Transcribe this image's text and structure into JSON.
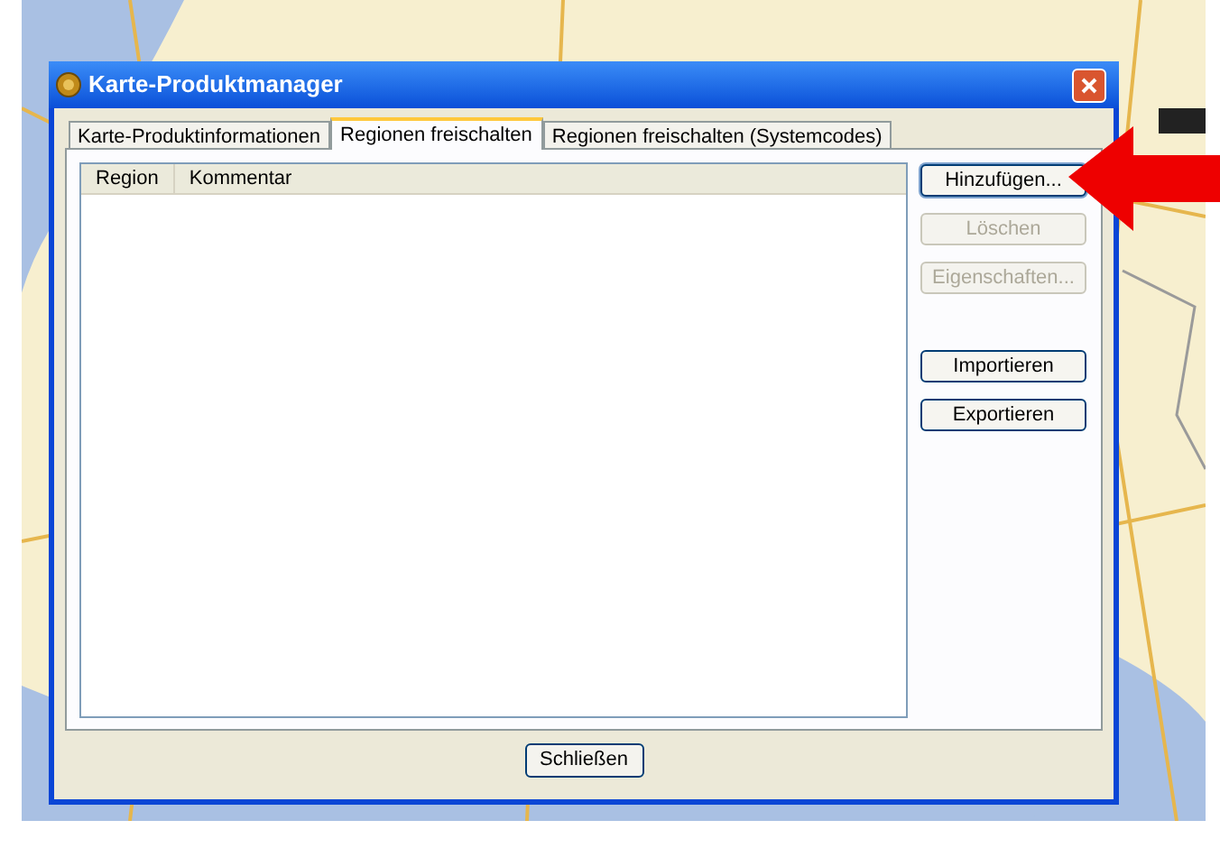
{
  "background": {
    "kind": "picture"
  },
  "window": {
    "title": "Karte-Produktmanager"
  },
  "tabs": [
    {
      "label": "Karte-Produktinformationen",
      "selected": false
    },
    {
      "label": "Regionen freischalten",
      "selected": true
    },
    {
      "label": "Regionen freischalten (Systemcodes)",
      "selected": false
    }
  ],
  "list": {
    "columns": [
      "Region",
      "Kommentar"
    ]
  },
  "button_groups": [
    [
      {
        "label": "Hinzufügen...",
        "disabled": false,
        "focused": true
      },
      {
        "label": "Löschen",
        "disabled": true,
        "focused": false
      },
      {
        "label": "Eigenschaften...",
        "disabled": true,
        "focused": false
      }
    ],
    [
      {
        "label": "Importieren",
        "disabled": false,
        "focused": false
      },
      {
        "label": "Exportieren",
        "disabled": false,
        "focused": false
      }
    ]
  ],
  "footer_button": {
    "label": "Schließen"
  },
  "annotation": {
    "kind": "arrow"
  }
}
